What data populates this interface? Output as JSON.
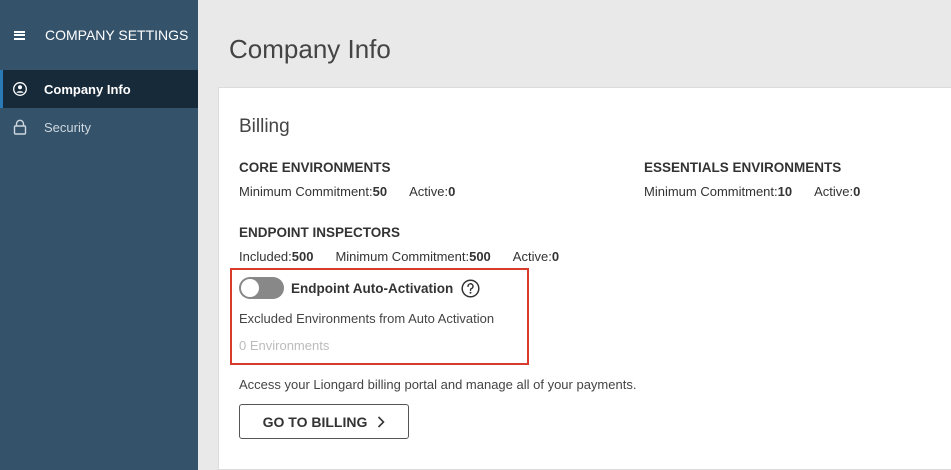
{
  "sidebar": {
    "title": "COMPANY SETTINGS",
    "items": [
      {
        "label": "Company Info",
        "icon": "user-circle-icon",
        "active": true
      },
      {
        "label": "Security",
        "icon": "lock-icon",
        "active": false
      }
    ]
  },
  "page": {
    "title": "Company Info"
  },
  "billing": {
    "title": "Billing",
    "core": {
      "heading": "CORE ENVIRONMENTS",
      "min_label": "Minimum Commitment:",
      "min_value": "50",
      "active_label": "Active:",
      "active_value": "0"
    },
    "essentials": {
      "heading": "ESSENTIALS ENVIRONMENTS",
      "min_label": "Minimum Commitment:",
      "min_value": "10",
      "active_label": "Active:",
      "active_value": "0"
    },
    "endpoint": {
      "heading": "ENDPOINT INSPECTORS",
      "included_label": "Included:",
      "included_value": "500",
      "min_label": "Minimum Commitment:",
      "min_value": "500",
      "active_label": "Active:",
      "active_value": "0"
    },
    "auto_activation": {
      "label": "Endpoint Auto-Activation",
      "enabled": false,
      "excluded_label": "Excluded Environments from Auto Activation",
      "excluded_count": "0 Environments"
    },
    "portal_text": "Access your Liongard billing portal and manage all of your payments.",
    "button_label": "GO TO BILLING"
  },
  "colors": {
    "sidebar_bg": "#34526a",
    "sidebar_active_bg": "#172a3a",
    "highlight_border": "#d83b2c",
    "toggle_off": "#888888"
  }
}
